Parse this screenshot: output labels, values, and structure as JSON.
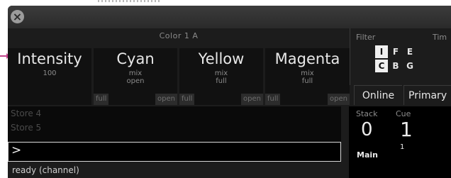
{
  "window": {
    "close_icon": "close-x-icon"
  },
  "color_section": {
    "label": "Color 1 A"
  },
  "panels": [
    {
      "name": "Intensity",
      "sub1": "100",
      "sub2": "",
      "foot_left": "",
      "foot_right": ""
    },
    {
      "name": "Cyan",
      "sub1": "mix",
      "sub2": "open",
      "foot_left": "full",
      "foot_right": "open"
    },
    {
      "name": "Yellow",
      "sub1": "mix",
      "sub2": "full",
      "foot_left": "full",
      "foot_right": "open"
    },
    {
      "name": "Magenta",
      "sub1": "mix",
      "sub2": "full",
      "foot_left": "full",
      "foot_right": "open"
    }
  ],
  "filter": {
    "title": "Filter",
    "cells": [
      {
        "label": "I",
        "active": true
      },
      {
        "label": "F",
        "active": false
      },
      {
        "label": "E",
        "active": false
      },
      {
        "label": "C",
        "active": true
      },
      {
        "label": "B",
        "active": false
      },
      {
        "label": "G",
        "active": false
      }
    ]
  },
  "timing": {
    "title": "Tim"
  },
  "tabs": {
    "online": "Online",
    "primary": "Primary"
  },
  "store_list": [
    "Store 4",
    "Store 5"
  ],
  "command_line": {
    "prompt": ">"
  },
  "status": {
    "text": "ready (channel)"
  },
  "playback": {
    "stack_label": "Stack",
    "stack_value": "0",
    "cue_label": "Cue",
    "cue_value": "1",
    "cue_sub": "1",
    "main_label": "Main"
  }
}
